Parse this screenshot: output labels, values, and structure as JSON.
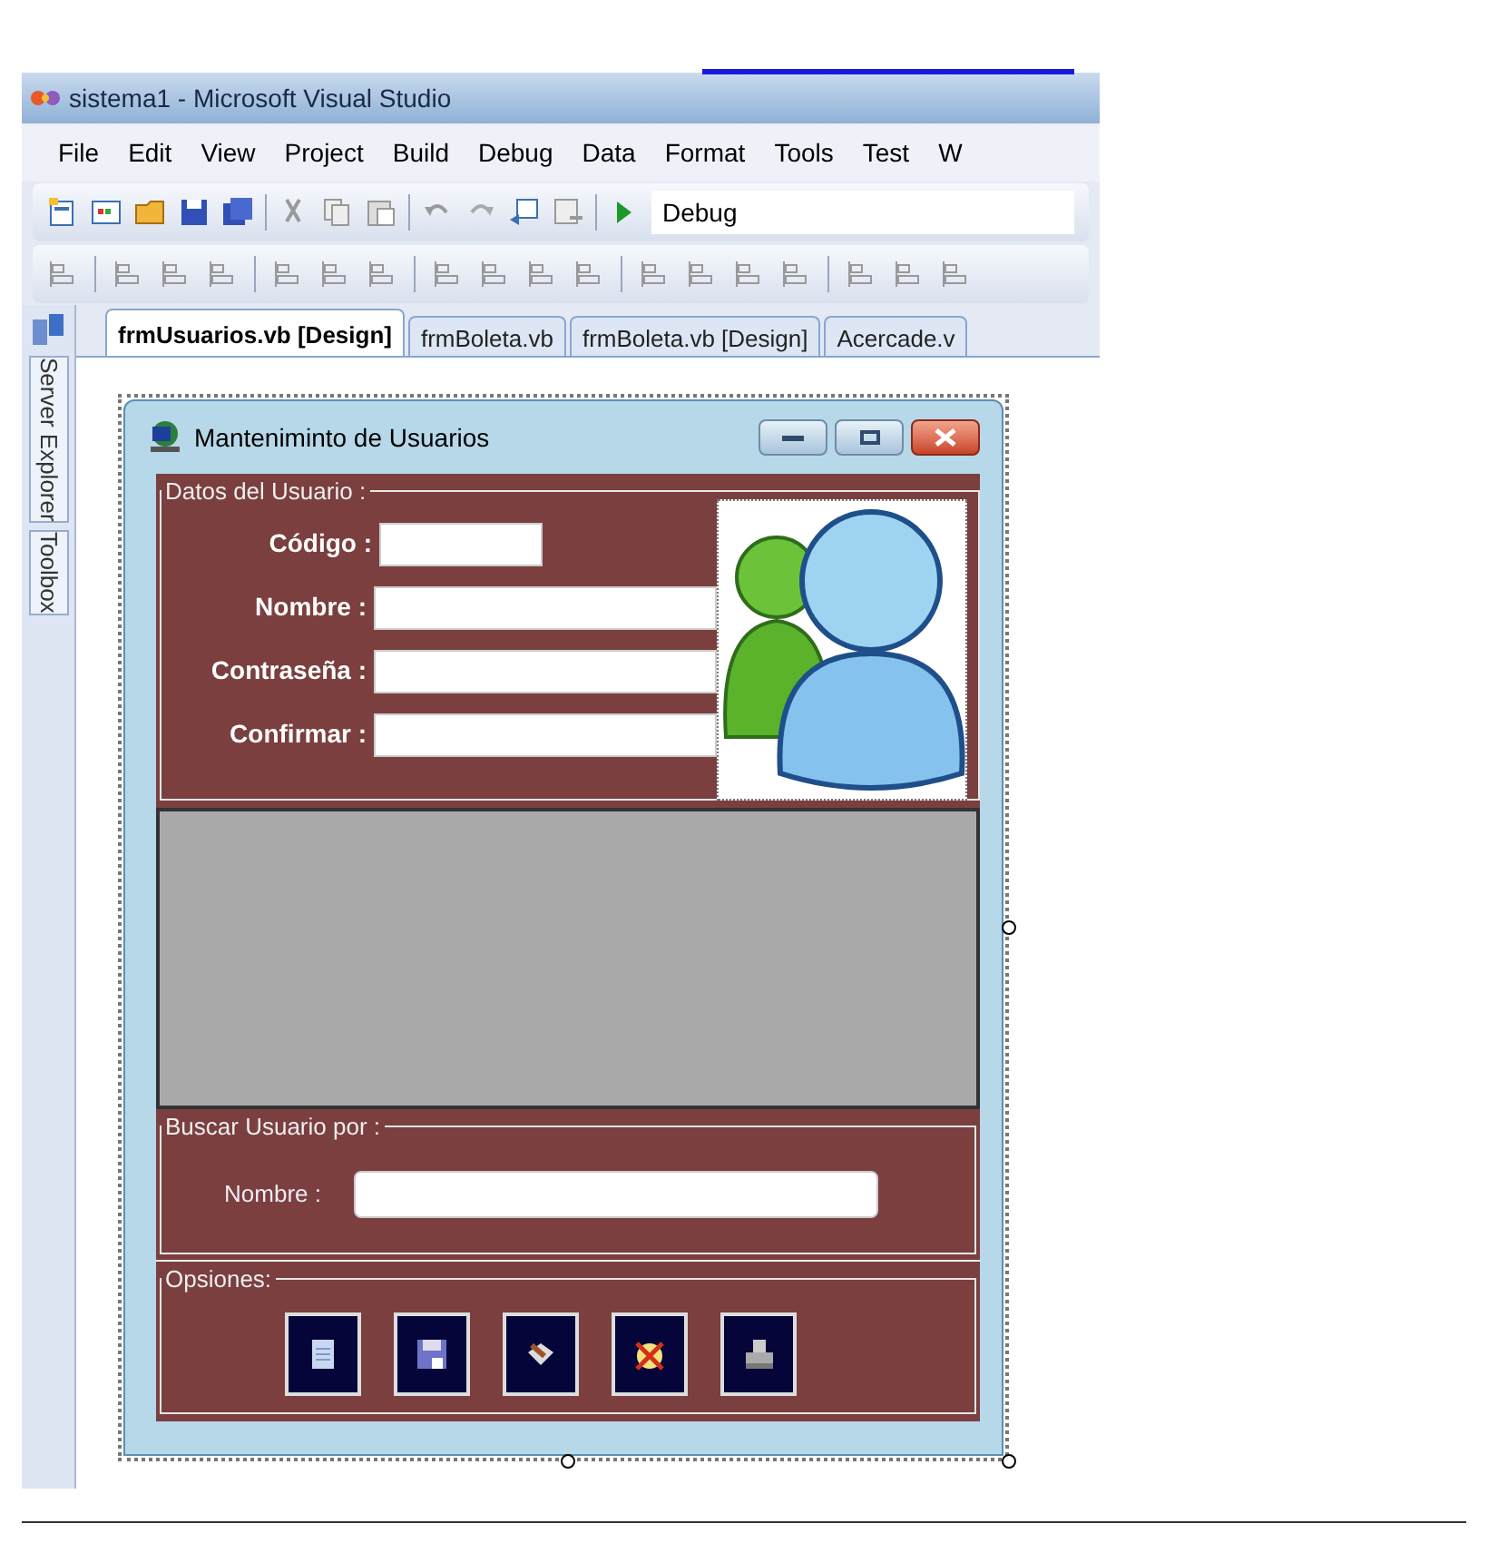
{
  "window": {
    "title": "sistema1 - Microsoft Visual Studio"
  },
  "menu": [
    "File",
    "Edit",
    "View",
    "Project",
    "Build",
    "Debug",
    "Data",
    "Format",
    "Tools",
    "Test",
    "W"
  ],
  "toolbar": {
    "configuration": "Debug"
  },
  "side_tabs": [
    {
      "label": "Server Explorer"
    },
    {
      "label": "Toolbox"
    }
  ],
  "tabs": [
    {
      "label": "frmUsuarios.vb [Design]",
      "selected": true
    },
    {
      "label": "frmBoleta.vb",
      "selected": false
    },
    {
      "label": "frmBoleta.vb [Design]",
      "selected": false
    },
    {
      "label": "Acercade.v",
      "selected": false
    }
  ],
  "form": {
    "title": "Manteniminto de Usuarios",
    "user_group": {
      "title": "Datos del Usuario :",
      "fields": [
        {
          "label": "Código :"
        },
        {
          "label": "Nombre :"
        },
        {
          "label": "Contraseña :"
        },
        {
          "label": "Confirmar :"
        }
      ]
    },
    "search_group": {
      "title": "Buscar Usuario por :",
      "fields": [
        {
          "label": "Nombre :"
        }
      ]
    },
    "options_group": {
      "title": "Opsiones:"
    }
  }
}
